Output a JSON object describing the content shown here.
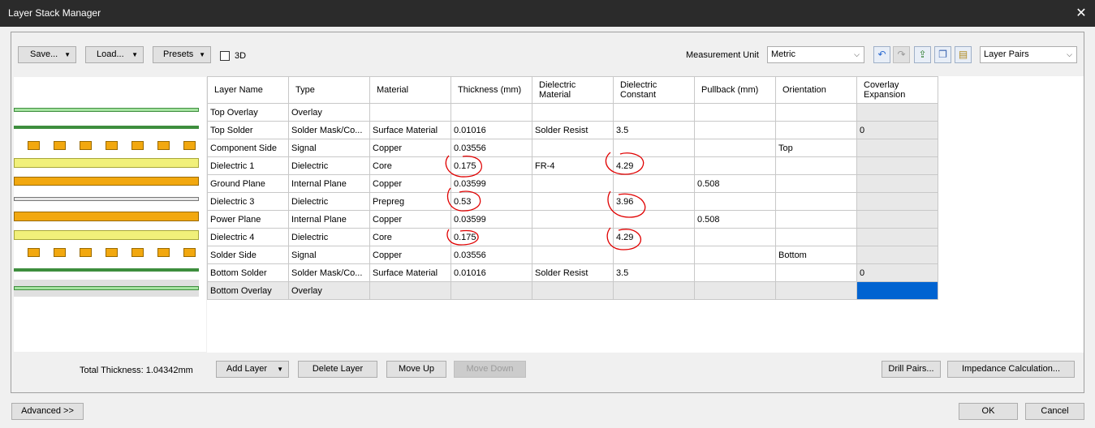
{
  "window": {
    "title": "Layer Stack Manager",
    "close_glyph": "✕"
  },
  "toolbar": {
    "save_label": "Save...",
    "load_label": "Load...",
    "presets_label": "Presets",
    "three_d_label": "3D",
    "measurement_unit_label": "Measurement Unit",
    "measurement_unit_value": "Metric",
    "layer_view_value": "Layer Pairs",
    "icons": [
      "undo-icon",
      "redo-icon",
      "import-icon",
      "copy-icon",
      "paste-icon"
    ]
  },
  "table": {
    "columns": [
      "Layer Name",
      "Type",
      "Material",
      "Thickness (mm)",
      "Dielectric\nMaterial",
      "Dielectric\nConstant",
      "Pullback (mm)",
      "Orientation",
      "Coverlay\nExpansion"
    ],
    "rows": [
      [
        "Top Overlay",
        "Overlay",
        "",
        "",
        "",
        "",
        "",
        "",
        ""
      ],
      [
        "Top Solder",
        "Solder Mask/Co...",
        "Surface Material",
        "0.01016",
        "Solder Resist",
        "3.5",
        "",
        "",
        "0"
      ],
      [
        "Component Side",
        "Signal",
        "Copper",
        "0.03556",
        "",
        "",
        "",
        "Top",
        ""
      ],
      [
        "Dielectric 1",
        "Dielectric",
        "Core",
        "0.175",
        "FR-4",
        "4.29",
        "",
        "",
        ""
      ],
      [
        "Ground Plane",
        "Internal Plane",
        "Copper",
        "0.03599",
        "",
        "",
        "0.508",
        "",
        ""
      ],
      [
        "Dielectric 3",
        "Dielectric",
        "Prepreg",
        "0.53",
        "",
        "3.96",
        "",
        "",
        ""
      ],
      [
        "Power Plane",
        "Internal Plane",
        "Copper",
        "0.03599",
        "",
        "",
        "0.508",
        "",
        ""
      ],
      [
        "Dielectric 4",
        "Dielectric",
        "Core",
        "0.175",
        "",
        "4.29",
        "",
        "",
        ""
      ],
      [
        "Solder Side",
        "Signal",
        "Copper",
        "0.03556",
        "",
        "",
        "",
        "Bottom",
        ""
      ],
      [
        "Bottom Solder",
        "Solder Mask/Co...",
        "Surface Material",
        "0.01016",
        "Solder Resist",
        "3.5",
        "",
        "",
        "0"
      ],
      [
        "Bottom Overlay",
        "Overlay",
        "",
        "",
        "",
        "",
        "",
        "",
        ""
      ]
    ],
    "selected_row_index": 10
  },
  "bottom": {
    "total_thickness": "Total Thickness: 1.04342mm",
    "add_layer_label": "Add Layer",
    "delete_layer_label": "Delete Layer",
    "move_up_label": "Move Up",
    "move_down_label": "Move Down",
    "drill_pairs_label": "Drill Pairs...",
    "impedance_label": "Impedance Calculation...",
    "advanced_label": "Advanced >>",
    "ok_label": "OK",
    "cancel_label": "Cancel"
  },
  "colors": {
    "titlebar": "#2b2b2b",
    "overlay_green": "#a6e3a1",
    "solder_green": "#3e8e3e",
    "copper_orange": "#f2a80f",
    "dielectric_yellow": "#f1f07a",
    "selection_blue": "#0063d1",
    "markup_red": "#e00000"
  }
}
